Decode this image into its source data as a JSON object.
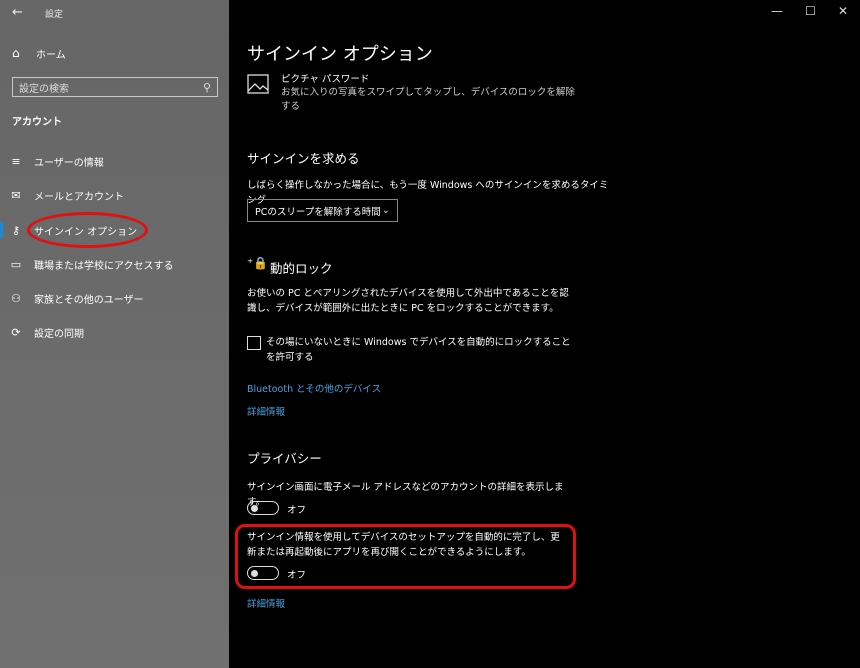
{
  "titlebar": {
    "back_icon": "arrow-left-icon",
    "title": "設定"
  },
  "window_controls": {
    "minimize": "—",
    "maximize": "☐",
    "close": "✕"
  },
  "sidebar": {
    "home_label": "ホーム",
    "search_placeholder": "設定の検索",
    "section": "アカウント",
    "items": [
      {
        "label": "ユーザーの情報",
        "icon": "user-info-icon"
      },
      {
        "label": "メールとアカウント",
        "icon": "mail-icon"
      },
      {
        "label": "サインイン オプション",
        "icon": "key-icon",
        "active": true
      },
      {
        "label": "職場または学校にアクセスする",
        "icon": "briefcase-icon"
      },
      {
        "label": "家族とその他のユーザー",
        "icon": "person-icon"
      },
      {
        "label": "設定の同期",
        "icon": "sync-icon"
      }
    ]
  },
  "main": {
    "title": "サインイン オプション",
    "picture_password": {
      "title": "ピクチャ パスワード",
      "desc": "お気に入りの写真をスワイプしてタップし、デバイスのロックを解除する"
    },
    "require_signin": {
      "heading": "サインインを求める",
      "desc": "しばらく操作しなかった場合に、もう一度 Windows へのサインインを求めるタイミング",
      "dropdown_value": "PCのスリープを解除する時間"
    },
    "dynamic_lock": {
      "heading": "動的ロック",
      "desc": "お使いの PC とペアリングされたデバイスを使用して外出中であることを認識し、デバイスが範囲外に出たときに PC をロックすることができます。",
      "checkbox_label": "その場にいないときに Windows でデバイスを自動的にロックすることを許可する",
      "checkbox_checked": false,
      "link_bt": "Bluetooth とその他のデバイス",
      "link_more": "詳細情報"
    },
    "privacy": {
      "heading": "プライバシー",
      "setting1": "サインイン画面に電子メール アドレスなどのアカウントの詳細を表示します。",
      "toggle1": "オフ",
      "setting2": "サインイン情報を使用してデバイスのセットアップを自動的に完了し、更新または再起動後にアプリを再び開くことができるようにします。",
      "toggle2": "オフ",
      "link_more": "詳細情報"
    }
  },
  "colors": {
    "accent": "#1a8ad4",
    "link": "#4aa3df",
    "annotation": "#e01010"
  }
}
